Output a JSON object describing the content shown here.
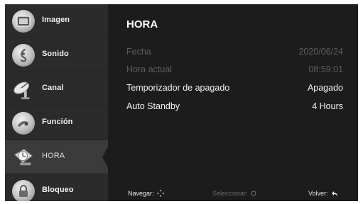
{
  "sidebar": {
    "items": [
      {
        "label": "Imagen",
        "icon": "picture-icon"
      },
      {
        "label": "Sonido",
        "icon": "music-note-icon"
      },
      {
        "label": "Canal",
        "icon": "satellite-dish-icon"
      },
      {
        "label": "Función",
        "icon": "gear-icon"
      },
      {
        "label": "HORA",
        "icon": "clock-icon",
        "selected": true
      },
      {
        "label": "Bloqueo",
        "icon": "padlock-icon"
      }
    ]
  },
  "main": {
    "title": "HORA",
    "rows": [
      {
        "label": "Fecha",
        "value": "2020/06/24",
        "enabled": false
      },
      {
        "label": "Hora actual",
        "value": "08:59:01",
        "enabled": false
      },
      {
        "label": "Temporizador de apagado",
        "value": "Apagado",
        "enabled": true
      },
      {
        "label": "Auto Standby",
        "value": "4 Hours",
        "enabled": true
      }
    ]
  },
  "footer": {
    "navigate": "Navegar:",
    "select": "Seleccionar:",
    "back": "Volver:"
  },
  "colors": {
    "background": "#1c1c1c",
    "sidebar": "#2b2b2b",
    "selected": "#3b3b3b",
    "text": "#f2f2f2",
    "disabled_text": "#5e5e5e"
  }
}
